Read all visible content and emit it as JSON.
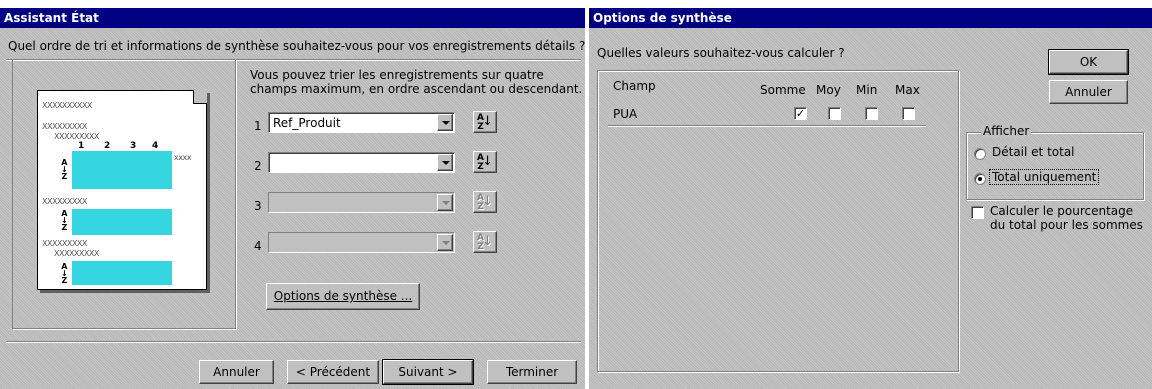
{
  "wizard": {
    "title": "Assistant État",
    "question": "Quel ordre de tri et informations de synthèse souhaitez-vous pour vos enregistrements détails ?",
    "instructions_line1": "Vous pouvez trier les enregistrements sur quatre",
    "instructions_line2": "champs maximum, en ordre ascendant ou descendant.",
    "sort_fields": [
      {
        "number": "1",
        "value": "Ref_Produit",
        "enabled": true
      },
      {
        "number": "2",
        "value": "",
        "enabled": true
      },
      {
        "number": "3",
        "value": "",
        "enabled": false
      },
      {
        "number": "4",
        "value": "",
        "enabled": false
      }
    ],
    "sort_button_label": "AZ",
    "summary_options_button": "Options de synthèse ...",
    "buttons": {
      "cancel": "Annuler",
      "previous": "< Précédent",
      "next": "Suivant >",
      "finish": "Terminer"
    },
    "preview": {
      "placeholder": "XXXXXXXXXX",
      "column_headers": [
        "1",
        "2",
        "3",
        "4"
      ],
      "az": "A\n↓\nZ"
    }
  },
  "summary": {
    "title": "Options de synthèse",
    "question": "Quelles valeurs souhaitez-vous calculer ?",
    "columns": {
      "field": "Champ",
      "sum": "Somme",
      "avg": "Moy",
      "min": "Min",
      "max": "Max"
    },
    "rows": [
      {
        "field": "PUA",
        "sum": true,
        "avg": false,
        "min": false,
        "max": false
      }
    ],
    "ok": "OK",
    "cancel": "Annuler",
    "show_group": "Afficher",
    "show_options": [
      {
        "label": "Détail et total",
        "selected": false
      },
      {
        "label": "Total uniquement",
        "selected": true
      }
    ],
    "percent_label_line1": "Calculer le pourcentage",
    "percent_label_line2": "du total pour les sommes",
    "percent_checked": false
  }
}
